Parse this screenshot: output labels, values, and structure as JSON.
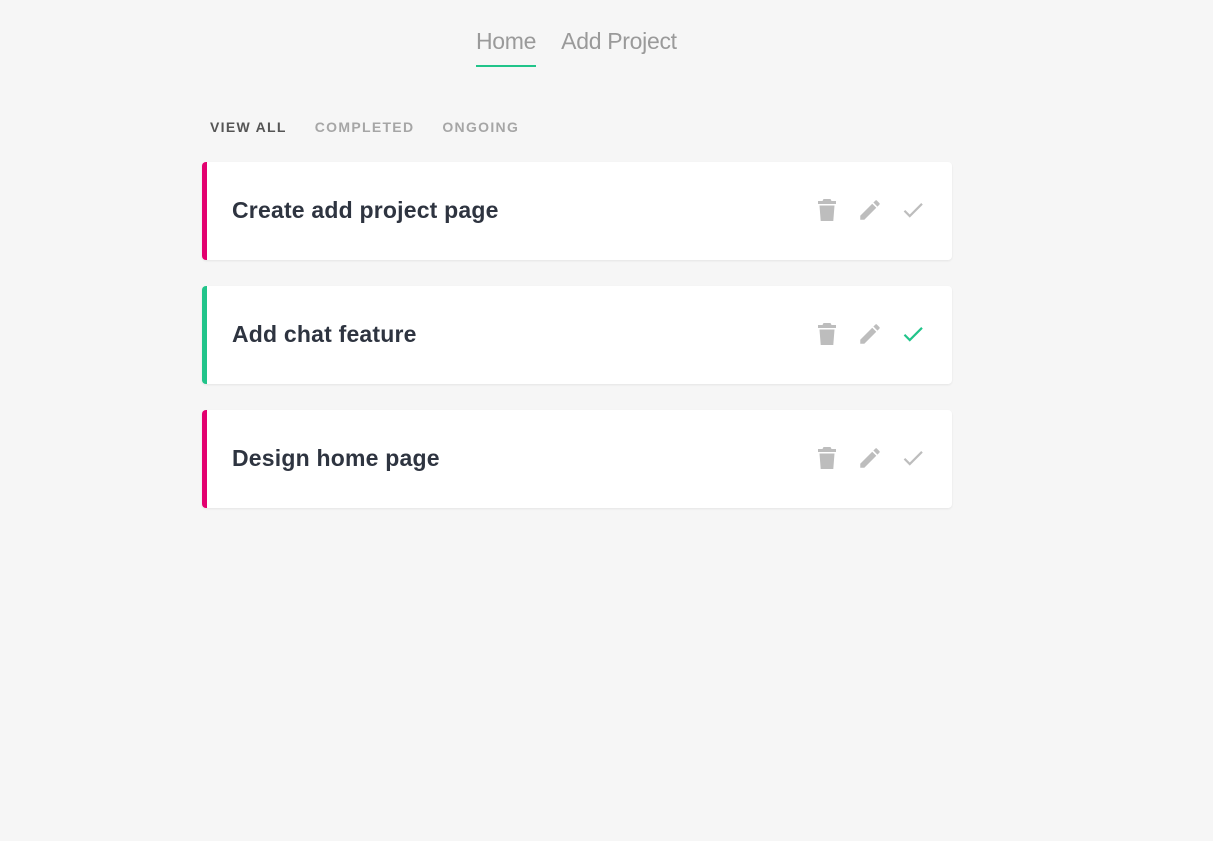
{
  "nav": {
    "links": [
      {
        "label": "Home",
        "active": true
      },
      {
        "label": "Add Project",
        "active": false
      }
    ]
  },
  "filters": [
    {
      "label": "VIEW ALL",
      "active": true
    },
    {
      "label": "COMPLETED",
      "active": false
    },
    {
      "label": "ONGOING",
      "active": false
    }
  ],
  "projects": [
    {
      "title": "Create add project page",
      "complete": false,
      "icons": [
        "delete-icon",
        "edit-icon",
        "check-icon"
      ]
    },
    {
      "title": "Add chat feature",
      "complete": true,
      "icons": [
        "delete-icon",
        "edit-icon",
        "check-icon"
      ]
    },
    {
      "title": "Design home page",
      "complete": false,
      "icons": [
        "delete-icon",
        "edit-icon",
        "check-icon"
      ]
    }
  ],
  "colors": {
    "background": "#f6f6f6",
    "accent_complete": "#21c48a",
    "accent_ongoing": "#e3006f",
    "icon_default": "#bdbdbd",
    "text_title": "#2e3440"
  }
}
